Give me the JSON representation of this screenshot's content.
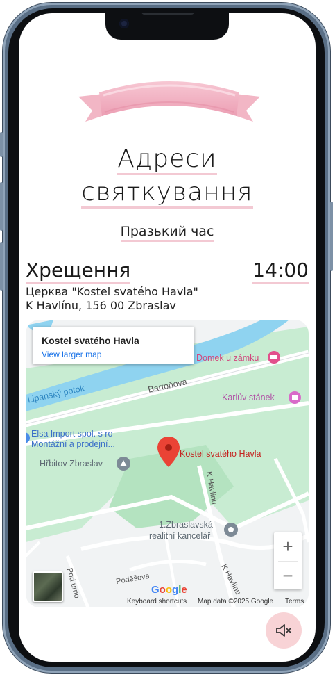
{
  "page": {
    "title_line1": "Адреси",
    "title_line2": "святкування",
    "subtitle": "Празький час"
  },
  "event": {
    "name": "Хрещення",
    "time": "14:00",
    "place_line1": "Церква \"Kostel svatého Havla\"",
    "place_line2": "K Havlínu, 156 00 Zbraslav"
  },
  "map": {
    "infobox_title": "Kostel svatého Havla",
    "infobox_link": "View larger map",
    "labels": {
      "pin": "Kostel svatého Havla",
      "domek": "Domek u zámku",
      "karluv": "Karlův stánek",
      "lipansky": "Lipanský potok",
      "bartonova": "Bartoňova",
      "elsa1": "Elsa Import spol. s ro-",
      "elsa2": "Montážní a prodejní...",
      "hrbitov": "Hřbitov Zbraslav",
      "havlinu_v": "K Havlínu",
      "havlinu_v2": "K Havlínu",
      "realitni1": "1.Zbraslavská",
      "realitni2": "realitní kancelář",
      "podesova": "Poděšova",
      "pod_urnou": "Pod urno"
    },
    "zoom_in": "+",
    "zoom_out": "−",
    "google": "Google",
    "footer_shortcuts": "Keyboard shortcuts",
    "footer_data": "Map data ©2025 Google",
    "footer_terms": "Terms"
  },
  "icons": {
    "mute": "speaker-muted-icon",
    "pin": "map-pin-icon",
    "ribbon": "pink-ribbon-banner"
  },
  "colors": {
    "accent_pink": "#f3c9d3",
    "mute_bg": "#f8d3d6",
    "map_green": "#c8ecd2",
    "map_water": "#8fd3f0",
    "pin_red": "#ea4335",
    "poi_pink": "#e2508c",
    "link_blue": "#1a73e8"
  }
}
